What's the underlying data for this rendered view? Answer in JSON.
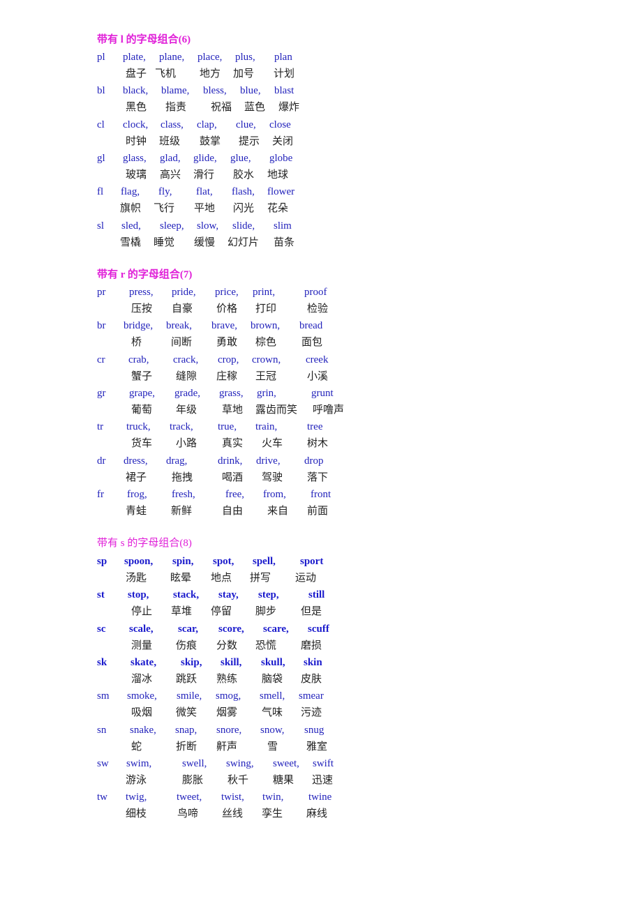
{
  "sections": [
    {
      "title": "带有 l 的字母组合(6)",
      "bold_title": true,
      "bold_words": false,
      "groups": [
        {
          "combo": "pl",
          "words": [
            "plate,",
            "plane,",
            "place,",
            "plus,",
            "plan"
          ],
          "meanings": [
            "盘子",
            "飞机",
            "地方",
            "加号",
            "计划"
          ]
        },
        {
          "combo": "bl",
          "words": [
            "black,",
            "blame,",
            "bless,",
            "blue,",
            "blast"
          ],
          "meanings": [
            "黑色",
            "指责",
            "祝福",
            "蓝色",
            "爆炸"
          ]
        },
        {
          "combo": "cl",
          "words": [
            "clock,",
            "class,",
            "clap,",
            "clue,",
            "close"
          ],
          "meanings": [
            "时钟",
            "班级",
            "鼓掌",
            "提示",
            "关闭"
          ]
        },
        {
          "combo": "gl",
          "words": [
            "glass,",
            "glad,",
            "glide,",
            "glue,",
            "globe"
          ],
          "meanings": [
            "玻璃",
            "高兴",
            "滑行",
            "胶水",
            "地球"
          ]
        },
        {
          "combo": "fl",
          "words": [
            "flag,",
            "fly,",
            "flat,",
            "flash,",
            "flower"
          ],
          "meanings": [
            "旗帜",
            "飞行",
            "平地",
            "闪光",
            "花朵"
          ]
        },
        {
          "combo": "sl",
          "words": [
            "sled,",
            "sleep,",
            "slow,",
            "slide,",
            "slim"
          ],
          "meanings": [
            "雪橇",
            "睡觉",
            "缓慢",
            "幻灯片",
            "苗条"
          ]
        }
      ]
    },
    {
      "title": "带有 r 的字母组合(7)",
      "bold_title": true,
      "bold_words": false,
      "groups": [
        {
          "combo": "pr",
          "words": [
            "press,",
            "pride,",
            "price,",
            "print,",
            "proof"
          ],
          "meanings": [
            "压按",
            "自豪",
            "价格",
            "打印",
            "检验"
          ]
        },
        {
          "combo": "br",
          "words": [
            "bridge,",
            "break,",
            "brave,",
            "brown,",
            "bread"
          ],
          "meanings": [
            "桥",
            "间断",
            "勇敢",
            "棕色",
            "面包"
          ]
        },
        {
          "combo": "cr",
          "words": [
            "crab,",
            "crack,",
            "crop,",
            "crown,",
            "creek"
          ],
          "meanings": [
            "蟹子",
            "缝隙",
            "庄稼",
            "王冠",
            "小溪"
          ]
        },
        {
          "combo": "gr",
          "words": [
            "grape,",
            "grade,",
            "grass,",
            "grin,",
            "grunt"
          ],
          "meanings": [
            "葡萄",
            "年级",
            "草地",
            "露齿而笑",
            "呼噜声"
          ]
        },
        {
          "combo": "tr",
          "words": [
            "truck,",
            "track,",
            "true,",
            "train,",
            "tree"
          ],
          "meanings": [
            "货车",
            "小路",
            "真实",
            "火车",
            "树木"
          ]
        },
        {
          "combo": "dr",
          "words": [
            "dress,",
            "drag,",
            "drink,",
            "drive,",
            "drop"
          ],
          "meanings": [
            "裙子",
            "拖拽",
            "喝酒",
            "驾驶",
            "落下"
          ]
        },
        {
          "combo": "fr",
          "words": [
            "frog,",
            "fresh,",
            "free,",
            "from,",
            "front"
          ],
          "meanings": [
            "青蛙",
            "新鲜",
            "自由",
            "来自",
            "前面"
          ]
        }
      ]
    },
    {
      "title": "带有 s 的字母组合(8)",
      "bold_title": false,
      "bold_words": true,
      "groups": [
        {
          "combo": "sp",
          "bold": true,
          "words": [
            "spoon,",
            "spin,",
            "spot,",
            "spell,",
            "sport"
          ],
          "meanings": [
            "汤匙",
            "眩晕",
            "地点",
            "拼写",
            "运动"
          ]
        },
        {
          "combo": "st",
          "bold": true,
          "words": [
            "stop,",
            "stack,",
            "stay,",
            "step,",
            "still"
          ],
          "meanings": [
            "停止",
            "草堆",
            "停留",
            "脚步",
            "但是"
          ]
        },
        {
          "combo": "sc",
          "bold": true,
          "words": [
            "scale,",
            "scar,",
            "score,",
            "scare,",
            "scuff"
          ],
          "meanings": [
            "测量",
            "伤痕",
            "分数",
            "恐慌",
            "磨损"
          ]
        },
        {
          "combo": "sk",
          "bold": true,
          "words": [
            "skate,",
            "skip,",
            "skill,",
            "skull,",
            "skin"
          ],
          "meanings": [
            "溜冰",
            "跳跃",
            "熟练",
            "脑袋",
            "皮肤"
          ]
        },
        {
          "combo": "sm",
          "bold": false,
          "words": [
            "smoke,",
            "smile,",
            "smog,",
            "smell,",
            "smear"
          ],
          "meanings": [
            "吸烟",
            "微笑",
            "烟雾",
            "气味",
            "污迹"
          ]
        },
        {
          "combo": "sn",
          "bold": false,
          "words": [
            "snake,",
            "snap,",
            "snore,",
            "snow,",
            "snug"
          ],
          "meanings": [
            "蛇",
            "折断",
            "鼾声",
            "雪",
            "雅室"
          ]
        },
        {
          "combo": "sw",
          "bold": false,
          "words": [
            "swim,",
            "swell,",
            "swing,",
            "sweet,",
            "swift"
          ],
          "meanings": [
            "游泳",
            "膨胀",
            "秋千",
            "糖果",
            "迅速"
          ]
        },
        {
          "combo": "tw",
          "bold": false,
          "words": [
            "twig,",
            "tweet,",
            "twist,",
            "twin,",
            "twine"
          ],
          "meanings": [
            "细枝",
            "鸟啼",
            "丝线",
            "孪生",
            "麻线"
          ]
        }
      ]
    }
  ]
}
